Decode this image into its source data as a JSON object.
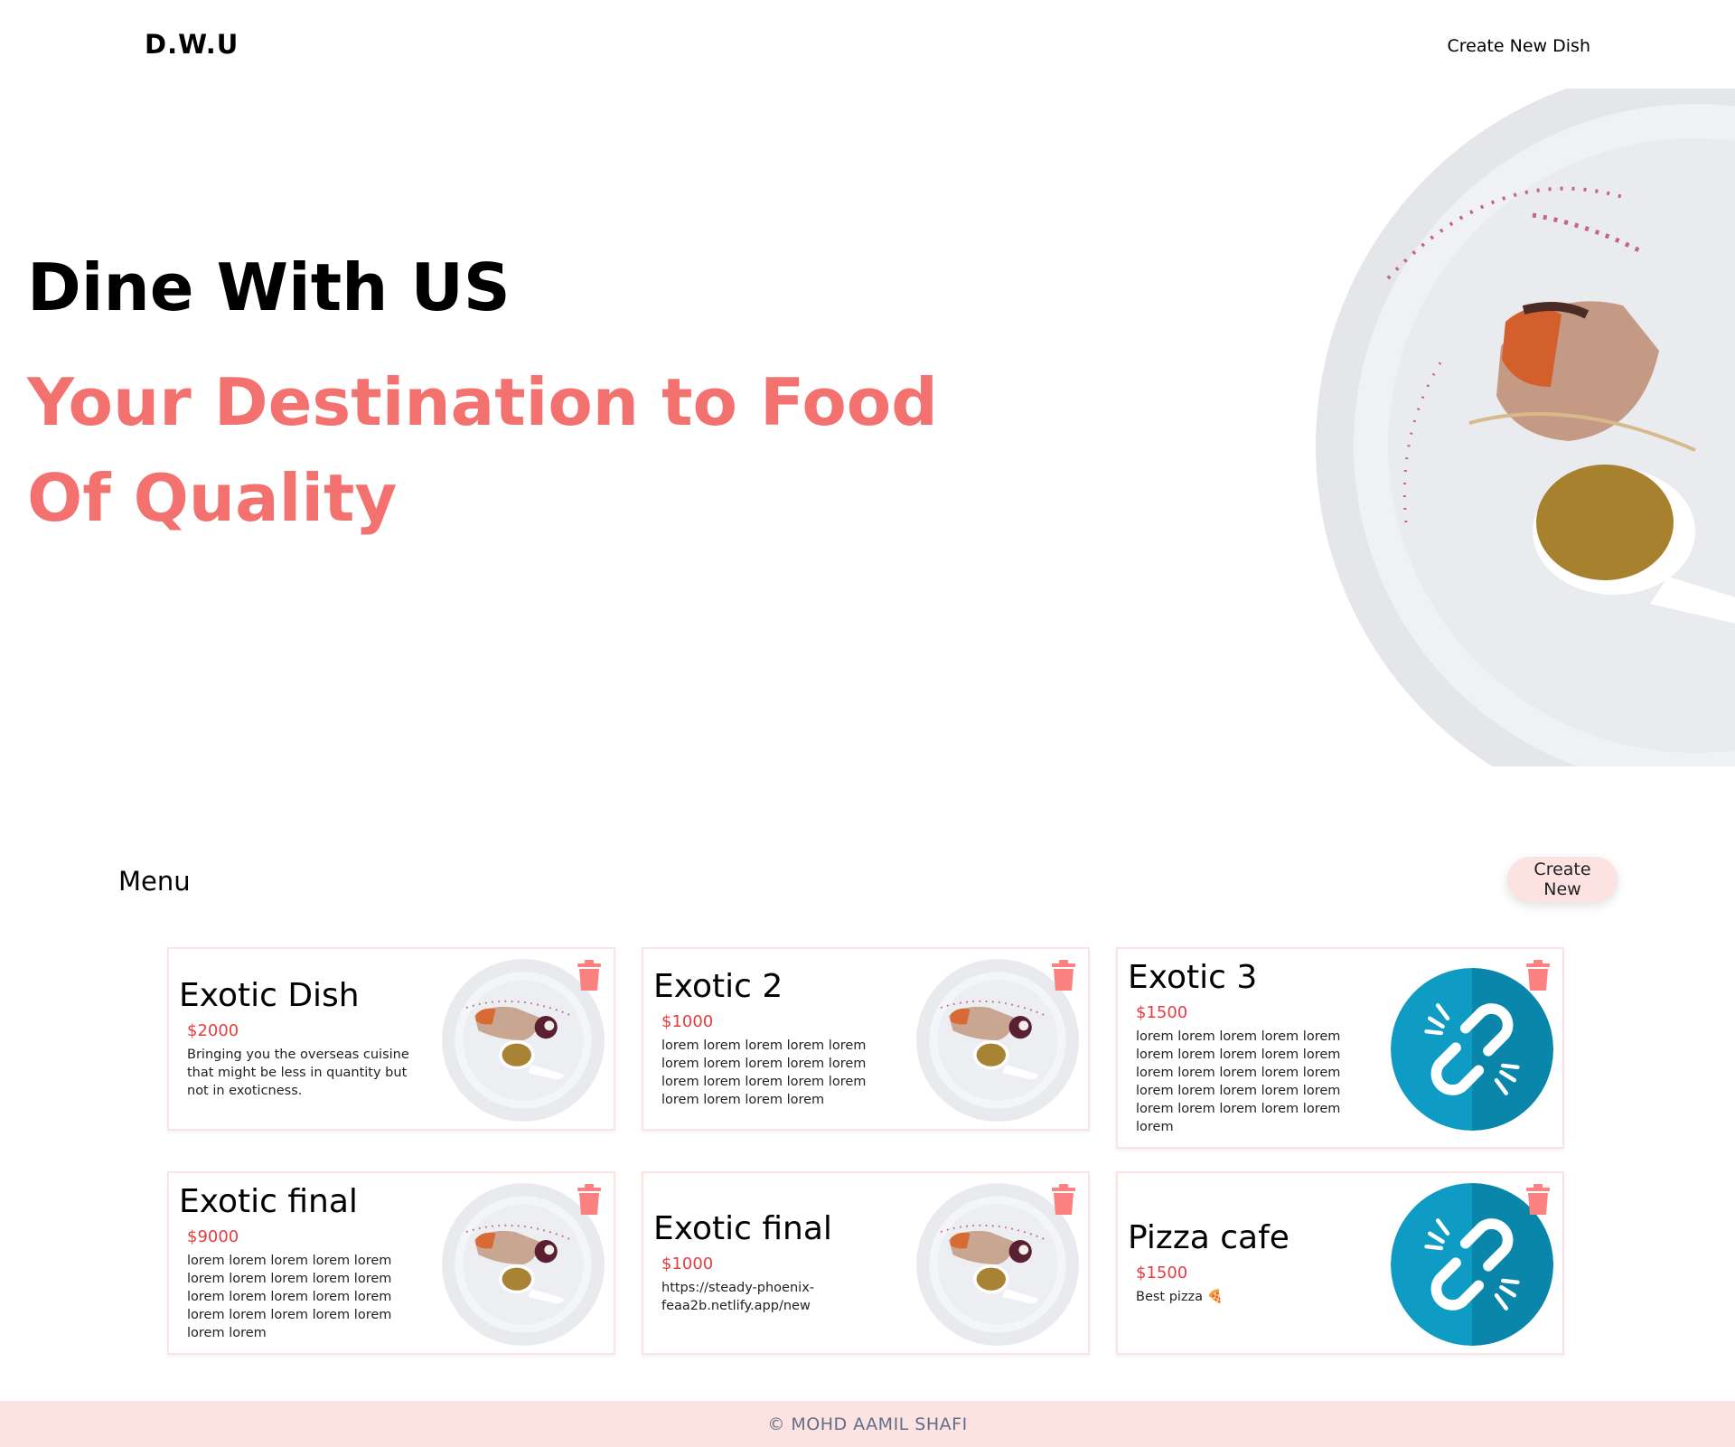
{
  "header": {
    "brand": "D.W.U",
    "nav_link": "Create New Dish"
  },
  "hero": {
    "title": "Dine With US",
    "subtitle_line1": "Your Destination to Food",
    "subtitle_line2": "Of Quality"
  },
  "menu": {
    "title": "Menu",
    "create_button": "Create New",
    "cards": [
      {
        "name": "Exotic Dish",
        "price": "$2000",
        "description": "Bringing you the overseas cuisine that might be less in quantity but not in exoticness.",
        "image": "plate-photo"
      },
      {
        "name": "Exotic 2",
        "price": "$1000",
        "description": "lorem lorem lorem lorem lorem lorem lorem lorem lorem lorem lorem lorem lorem lorem lorem lorem lorem lorem lorem",
        "image": "plate-photo"
      },
      {
        "name": "Exotic 3",
        "price": "$1500",
        "description": "lorem lorem lorem lorem lorem lorem lorem lorem lorem lorem lorem lorem lorem lorem lorem lorem lorem lorem lorem lorem lorem lorem lorem lorem lorem lorem",
        "image": "broken-link-icon"
      },
      {
        "name": "Exotic final",
        "price": "$9000",
        "description": "lorem lorem lorem lorem lorem lorem lorem lorem lorem lorem lorem lorem lorem lorem lorem lorem lorem lorem lorem lorem lorem lorem",
        "image": "plate-photo"
      },
      {
        "name": "Exotic final",
        "price": "$1000",
        "description": "https://steady-phoenix-feaa2b.netlify.app/new",
        "image": "plate-photo"
      },
      {
        "name": "Pizza cafe",
        "price": "$1500",
        "description": "Best pizza 🍕",
        "image": "broken-link-icon"
      }
    ]
  },
  "footer": {
    "text": "© MOHD AAMIL SHAFI"
  },
  "colors": {
    "accent": "#f3726f",
    "price": "#e53e3e",
    "trash": "#fc8181",
    "footer_bg": "#fde2e2",
    "broken_link": "#0e9bc4"
  }
}
